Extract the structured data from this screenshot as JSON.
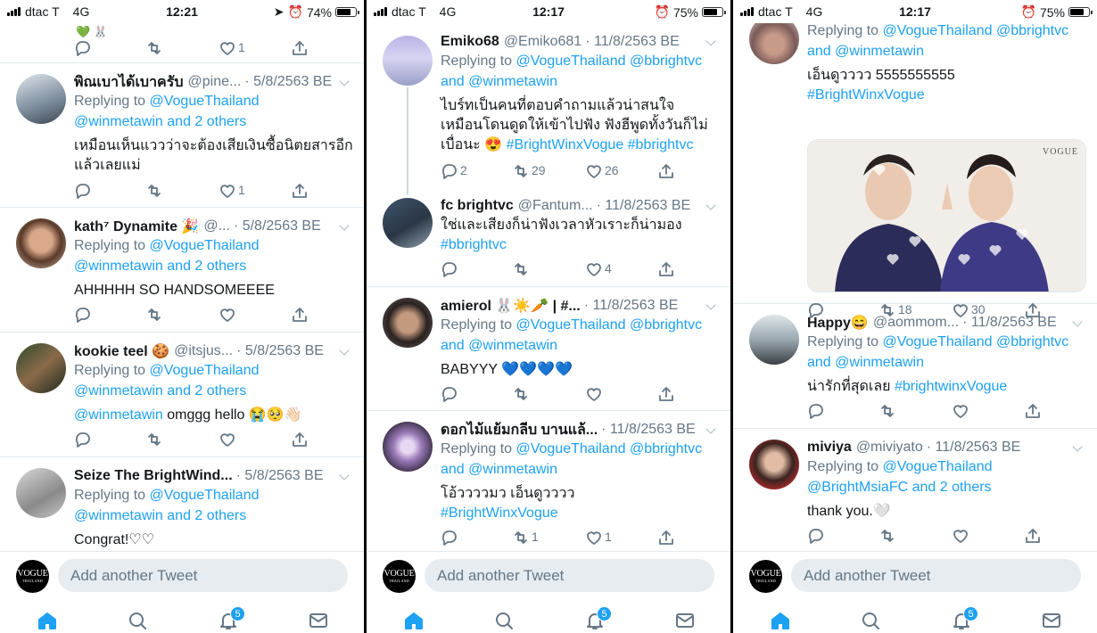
{
  "colors": {
    "accent": "#1da1f2",
    "muted": "#657786",
    "divider": "#e1e8ed"
  },
  "common": {
    "compose_placeholder": "Add another Tweet",
    "logo_text": "VOGUE",
    "logo_sub": "THAILAND",
    "notifications_badge": "5",
    "replying_to": "Replying to"
  },
  "screens": [
    {
      "status": {
        "carrier": "dtac T",
        "network": "4G",
        "time": "12:21",
        "battery": "74%",
        "battery_level": 0.74
      },
      "top_actions": {
        "likes": "1"
      },
      "tweets": [
        {
          "name": "พิณเบาได้เบาครับ",
          "handle": "@pine...",
          "date": "5/8/2563 BE",
          "replying": [
            "@VogueThailand",
            "@winmetawin and 2 others"
          ],
          "text": "เหมือนเห็นแววว่าจะต้องเสียเงินซื้อนิตยสารอีกแล้วเลยแม่",
          "retweets": "",
          "likes": "1"
        },
        {
          "name": "kath⁷ Dynamite 🎉",
          "handle": "@...",
          "date": "5/8/2563 BE",
          "replying": [
            "@VogueThailand",
            "@winmetawin and 2 others"
          ],
          "text": "AHHHHH SO HANDSOMEEEE",
          "retweets": "",
          "likes": ""
        },
        {
          "name": "kookie teel 🍪",
          "handle": "@itsjus...",
          "date": "5/8/2563 BE",
          "replying": [
            "@VogueThailand",
            "@winmetawin and 2 others"
          ],
          "text_mention": "@winmetawin",
          "text": " omggg hello 😭🥺👋🏻",
          "retweets": "",
          "likes": ""
        },
        {
          "name": "Seize The BrightWind...",
          "handle": "",
          "date": "5/8/2563 BE",
          "replying": [
            "@VogueThailand",
            "@winmetawin and 2 others"
          ],
          "text": "Congrat!♡♡"
        }
      ]
    },
    {
      "status": {
        "carrier": "dtac T",
        "network": "4G",
        "time": "12:17",
        "battery": "75%",
        "battery_level": 0.75
      },
      "tweets": [
        {
          "name": "Emiko68",
          "handle": "@Emiko681",
          "date": "· 11/8/2563 BE",
          "replying": [
            "@VogueThailand",
            "@bbrightvc",
            "and",
            "@winmetawin"
          ],
          "text": "ไบร์ทเป็นคนที่ตอบคำถามแล้วน่าสนใจ เหมือนโดนดูดให้เข้าไปฟัง ฟังฮีพูดทั้งวันก็ไม่เบื่อนะ 😍 ",
          "tags": "#BrightWinxVogue #bbrightvc",
          "replies": "2",
          "retweets": "29",
          "likes": "26"
        },
        {
          "name": "fc brightvc",
          "handle": "@Fantum...",
          "date": "· 11/8/2563 BE",
          "text": "ใช่และเสียงก็น่าฟังเวลาหัวเราะก็น่ามอง ",
          "tags": "#bbrightvc",
          "replies": "",
          "retweets": "",
          "likes": "4"
        },
        {
          "name": "amierol 🐰☀️🥕 | #...",
          "handle": "",
          "date": "· 11/8/2563 BE",
          "replying": [
            "@VogueThailand",
            "@bbrightvc",
            "and",
            "@winmetawin"
          ],
          "text": "BABYYY 💙💙💙💙",
          "replies": "",
          "retweets": "",
          "likes": ""
        },
        {
          "name": "ดอกไม้แย้มกลีบ บานแล้...",
          "handle": "",
          "date": "· 11/8/2563 BE",
          "replying": [
            "@VogueThailand",
            "@bbrightvc",
            "and",
            "@winmetawin"
          ],
          "text": "โอ้ววววมว เอ็นดูวววว",
          "tags": "#BrightWinxVogue",
          "replies": "",
          "retweets": "1",
          "likes": "1"
        }
      ]
    },
    {
      "status": {
        "carrier": "dtac T",
        "network": "4G",
        "time": "12:17",
        "battery": "75%",
        "battery_level": 0.75
      },
      "tweets": [
        {
          "replying": [
            "@VogueThailand",
            "@bbrightvc",
            "and",
            "@winmetawin"
          ],
          "text": "เอ็นดูวววว 5555555555",
          "tags": "#BrightWinxVogue",
          "media_mark": "VOGUE",
          "replies": "",
          "retweets": "18",
          "likes": "30"
        },
        {
          "name": "Happy😄",
          "handle": "@aommom...",
          "date": "· 11/8/2563 BE",
          "replying": [
            "@VogueThailand",
            "@bbrightvc",
            "and",
            "@winmetawin"
          ],
          "text": "น่ารักที่สุดเลย ",
          "tags": "#brightwinxVogue",
          "replies": "",
          "retweets": "",
          "likes": ""
        },
        {
          "name": "miviya",
          "handle": "@miviyato",
          "date": "· 11/8/2563 BE",
          "replying": [
            "@VogueThailand",
            "@BrightMsiaFC and 2 others"
          ],
          "text": "thank you.🤍",
          "replies": "",
          "retweets": "",
          "likes": ""
        }
      ]
    }
  ]
}
